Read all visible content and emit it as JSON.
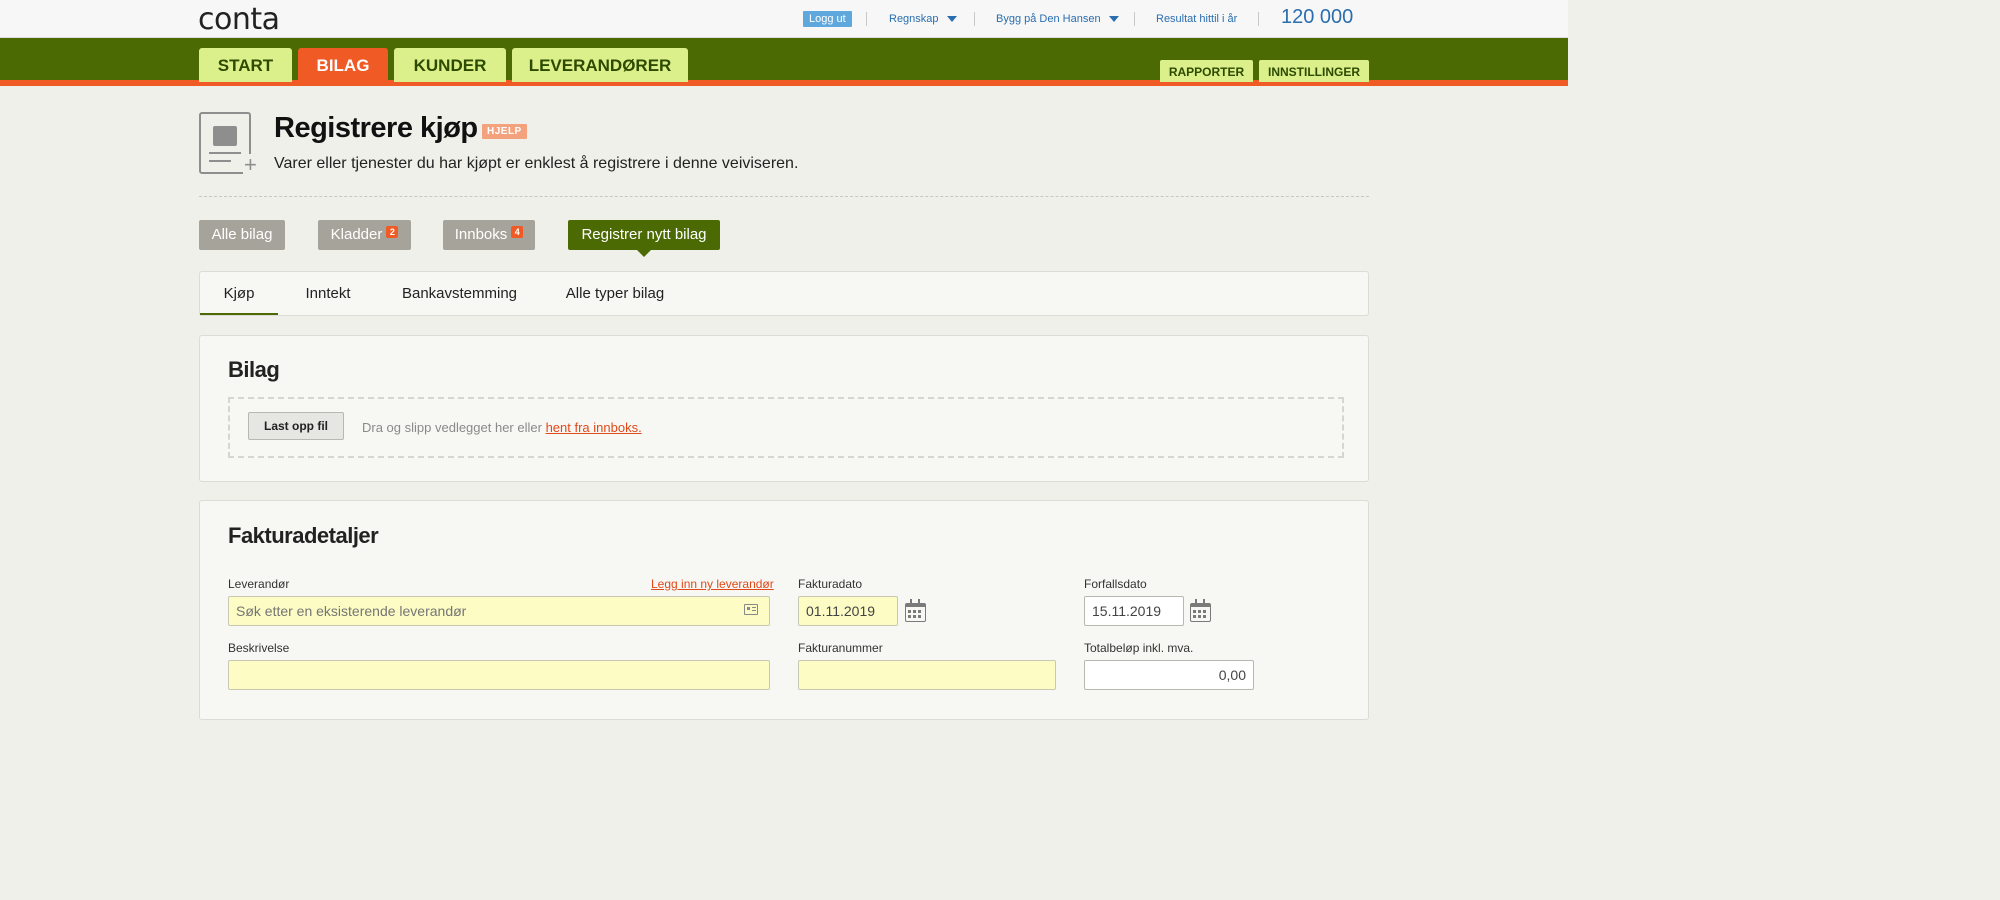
{
  "topbar": {
    "logo": "conta",
    "logout_label": "Logg ut",
    "menu_regnskap": "Regnskap",
    "company": "Bygg på Den Hansen",
    "result_label": "Resultat hittil i år",
    "result_amount": "120 000"
  },
  "nav": {
    "tabs": [
      {
        "label": "START"
      },
      {
        "label": "BILAG"
      },
      {
        "label": "KUNDER"
      },
      {
        "label": "LEVERANDØRER"
      }
    ],
    "subtabs": [
      {
        "label": "RAPPORTER"
      },
      {
        "label": "INNSTILLINGER"
      }
    ],
    "active_tab": "BILAG"
  },
  "header": {
    "title": "Registrere kjøp",
    "help_label": "HJELP",
    "subtitle": "Varer eller tjenester du har kjøpt er enklest å registrere i denne veiviseren."
  },
  "section_buttons": [
    {
      "label": "Alle bilag",
      "badge": null
    },
    {
      "label": "Kladder",
      "badge": "2"
    },
    {
      "label": "Innboks",
      "badge": "4"
    },
    {
      "label": "Registrer nytt bilag",
      "badge": null
    }
  ],
  "type_tabs": [
    {
      "label": "Kjøp"
    },
    {
      "label": "Inntekt"
    },
    {
      "label": "Bankavstemming"
    },
    {
      "label": "Alle typer bilag"
    }
  ],
  "bilag": {
    "title": "Bilag",
    "upload_label": "Last opp fil",
    "drop_text": "Dra og slipp vedlegget her eller ",
    "drop_link": "hent fra innboks."
  },
  "faktura": {
    "title": "Fakturadetaljer",
    "leverandor_label": "Leverandør",
    "new_supplier_link": "Legg inn ny leverandør",
    "leverandor_placeholder": "Søk etter en eksisterende leverandør",
    "fakturadato_label": "Fakturadato",
    "fakturadato_value": "01.11.2019",
    "forfallsdato_label": "Forfallsdato",
    "forfallsdato_value": "15.11.2019",
    "beskrivelse_label": "Beskrivelse",
    "beskrivelse_value": "",
    "fakturanummer_label": "Fakturanummer",
    "fakturanummer_value": "",
    "total_label": "Totalbeløp inkl. mva.",
    "total_value": "0,00"
  },
  "colors": {
    "nav_green": "#4c6a03",
    "accent_orange": "#f05a24",
    "tab_lime": "#dbf08a",
    "link_blue": "#2a6eb0",
    "input_yellow": "#fcfcc4"
  }
}
